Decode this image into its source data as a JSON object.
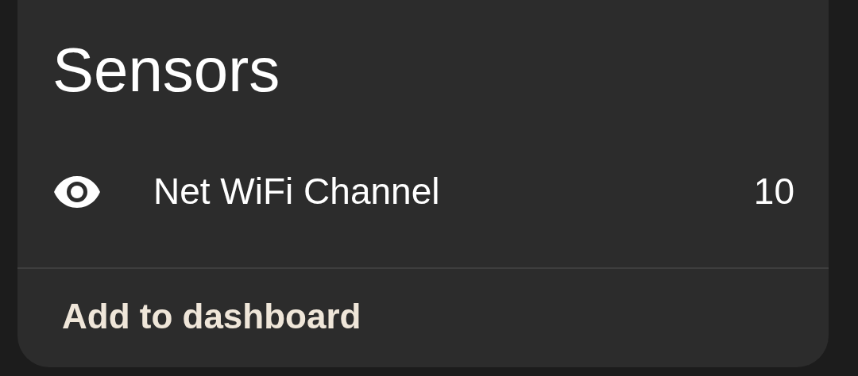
{
  "card": {
    "title": "Sensors",
    "entities": [
      {
        "name": "Net WiFi Channel",
        "state": "10"
      }
    ],
    "action": "Add to dashboard"
  }
}
